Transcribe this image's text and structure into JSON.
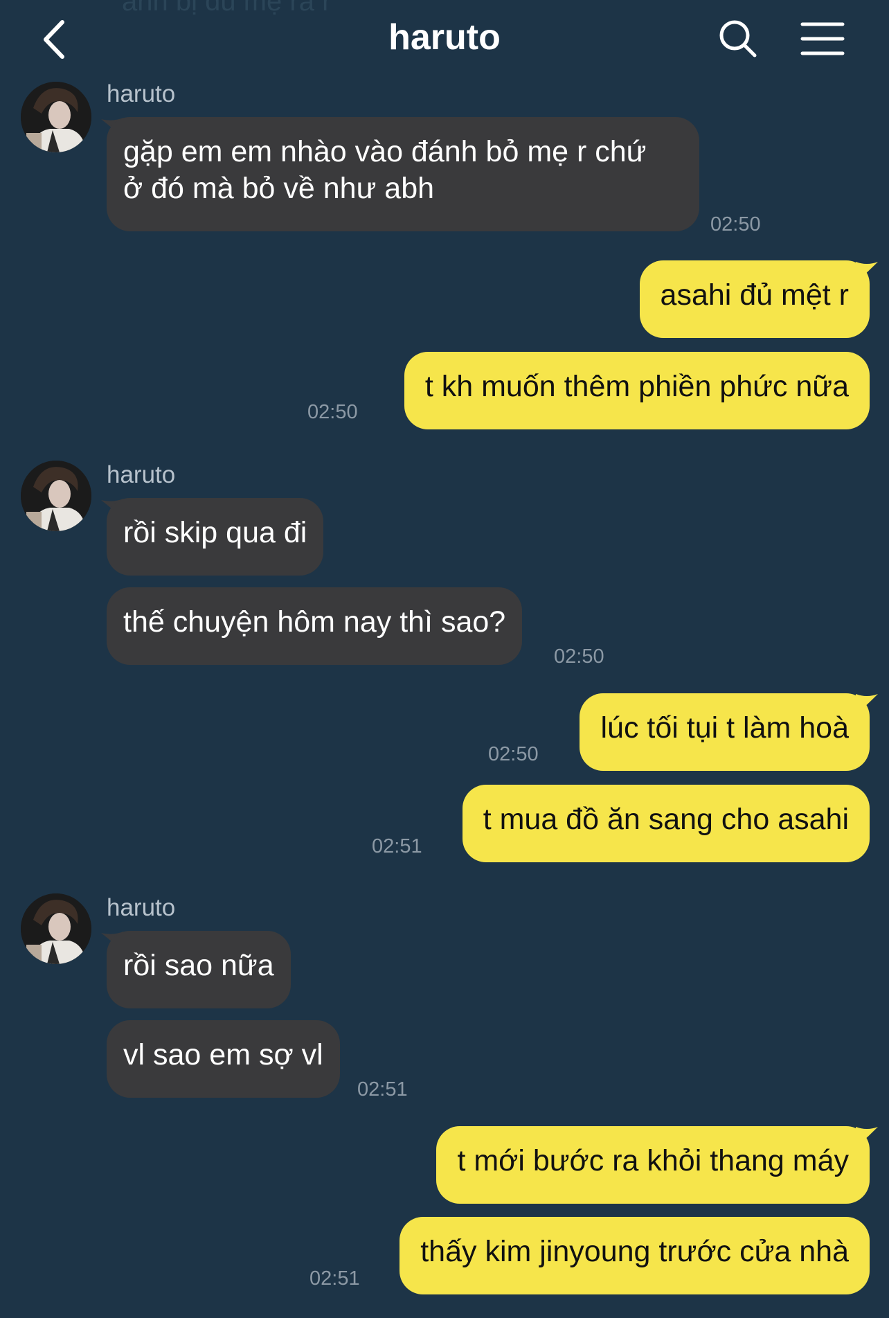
{
  "top_partial_text": "anh bị đủ mẹ ra r",
  "header": {
    "title": "haruto"
  },
  "messages": {
    "g1_sender": "haruto",
    "m1": "gặp em em nhào vào đánh bỏ mẹ r chứ\nở đó mà bỏ về như abh",
    "m1_time": "02:50",
    "m2": "asahi đủ mệt r",
    "m3": "t kh muốn thêm phiền phức nữa",
    "m3_time": "02:50",
    "g2_sender": "haruto",
    "m4": "rồi skip qua đi",
    "m5": "thế chuyện hôm nay thì sao?",
    "m5_time": "02:50",
    "m6": "lúc tối tụi t làm hoà",
    "m6_time": "02:50",
    "m7": "t mua đồ ăn sang cho asahi",
    "m7_time": "02:51",
    "g3_sender": "haruto",
    "m8": "rồi sao nữa",
    "m9": "vl sao em sợ vl",
    "m9_time": "02:51",
    "m10": "t mới bước ra khỏi thang máy",
    "m11": "thấy kim jinyoung trước cửa nhà",
    "m11_time": "02:51"
  },
  "colors": {
    "background": "#1d3447",
    "incoming_bubble": "#3a3a3c",
    "outgoing_bubble": "#f6e54b",
    "timestamp": "#8c99a5"
  },
  "icons": {
    "back": "chevron-left-icon",
    "search": "search-icon",
    "menu": "hamburger-menu-icon"
  }
}
